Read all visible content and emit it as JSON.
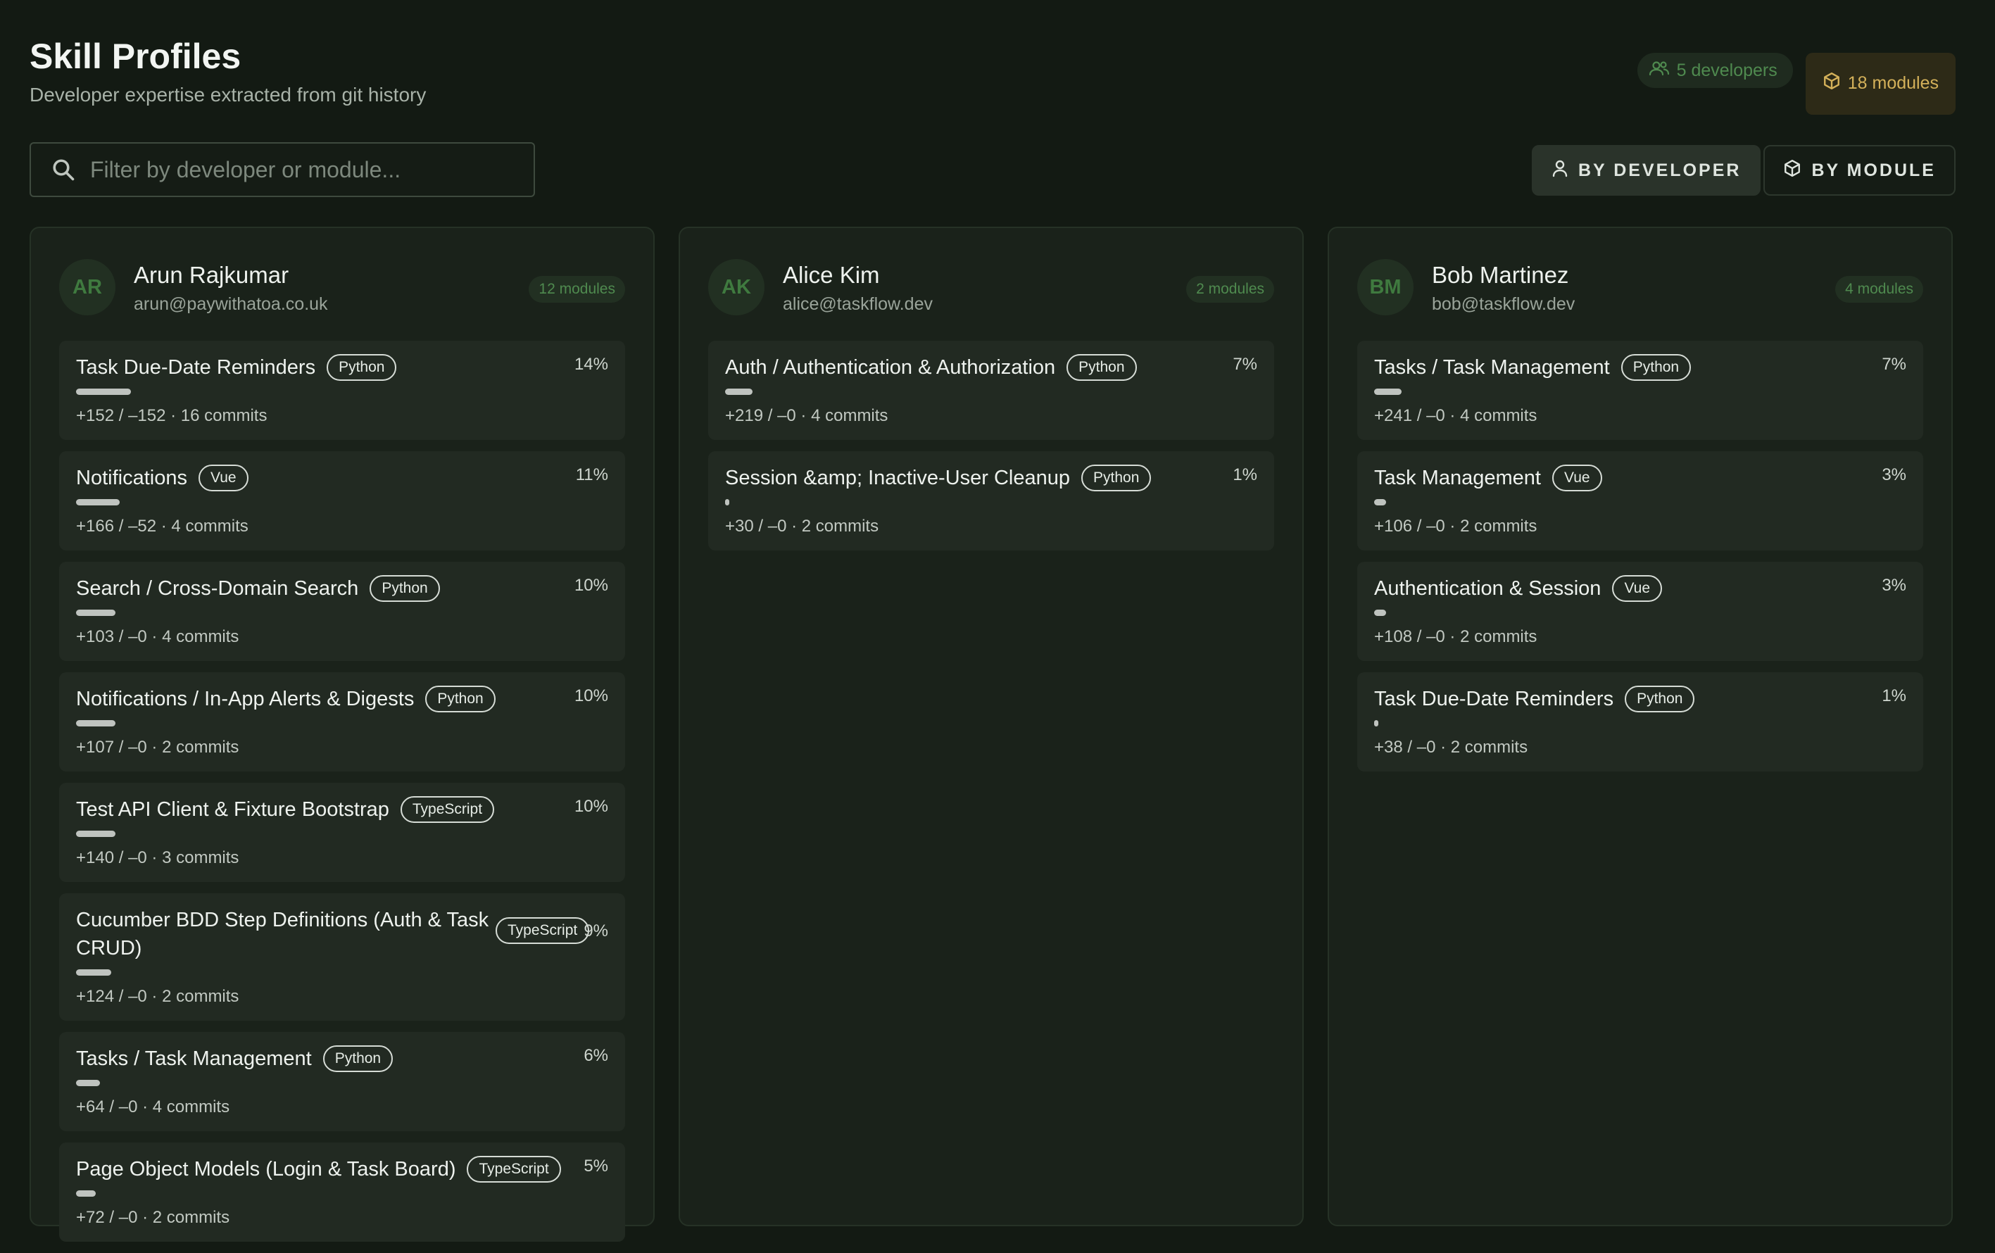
{
  "header": {
    "title": "Skill Profiles",
    "subtitle": "Developer expertise extracted from git history",
    "developers_badge": "5 developers",
    "modules_badge": "18 modules"
  },
  "search": {
    "placeholder": "Filter by developer or module..."
  },
  "view_toggle": {
    "by_developer": "BY DEVELOPER",
    "by_module": "BY MODULE",
    "active": "BY DEVELOPER"
  },
  "colors": {
    "accent_green": "#4f8a4f",
    "accent_gold": "#d4b15a",
    "background": "#131a13"
  },
  "developers": [
    {
      "initials": "AR",
      "name": "Arun Rajkumar",
      "email": "arun@paywithatoa.co.uk",
      "module_count": "12 modules",
      "modules": [
        {
          "name": "Task Due-Date Reminders",
          "lang": "Python",
          "pct": "14%",
          "share": 0.14,
          "stats": "+152 / –152 · 16 commits"
        },
        {
          "name": "Notifications",
          "lang": "Vue",
          "pct": "11%",
          "share": 0.11,
          "stats": "+166 / –52 · 4 commits"
        },
        {
          "name": "Search / Cross-Domain Search",
          "lang": "Python",
          "pct": "10%",
          "share": 0.1,
          "stats": "+103 / –0 · 4 commits"
        },
        {
          "name": "Notifications / In-App Alerts & Digests",
          "lang": "Python",
          "pct": "10%",
          "share": 0.1,
          "stats": "+107 / –0 · 2 commits"
        },
        {
          "name": "Test API Client & Fixture Bootstrap",
          "lang": "TypeScript",
          "pct": "10%",
          "share": 0.1,
          "stats": "+140 / –0 · 3 commits"
        },
        {
          "name": "Cucumber BDD Step Definitions (Auth & Task CRUD)",
          "lang": "TypeScript",
          "pct": "9%",
          "share": 0.09,
          "stats": "+124 / –0 · 2 commits"
        },
        {
          "name": "Tasks / Task Management",
          "lang": "Python",
          "pct": "6%",
          "share": 0.06,
          "stats": "+64 / –0 · 4 commits"
        },
        {
          "name": "Page Object Models (Login & Task Board)",
          "lang": "TypeScript",
          "pct": "5%",
          "share": 0.05,
          "stats": "+72 / –0 · 2 commits"
        }
      ]
    },
    {
      "initials": "AK",
      "name": "Alice Kim",
      "email": "alice@taskflow.dev",
      "module_count": "2 modules",
      "modules": [
        {
          "name": "Auth / Authentication & Authorization",
          "lang": "Python",
          "pct": "7%",
          "share": 0.07,
          "stats": "+219 / –0 · 4 commits"
        },
        {
          "name": "Session &amp; Inactive-User Cleanup",
          "lang": "Python",
          "pct": "1%",
          "share": 0.01,
          "stats": "+30 / –0 · 2 commits"
        }
      ]
    },
    {
      "initials": "BM",
      "name": "Bob Martinez",
      "email": "bob@taskflow.dev",
      "module_count": "4 modules",
      "modules": [
        {
          "name": "Tasks / Task Management",
          "lang": "Python",
          "pct": "7%",
          "share": 0.07,
          "stats": "+241 / –0 · 4 commits"
        },
        {
          "name": "Task Management",
          "lang": "Vue",
          "pct": "3%",
          "share": 0.03,
          "stats": "+106 / –0 · 2 commits"
        },
        {
          "name": "Authentication & Session",
          "lang": "Vue",
          "pct": "3%",
          "share": 0.03,
          "stats": "+108 / –0 · 2 commits"
        },
        {
          "name": "Task Due-Date Reminders",
          "lang": "Python",
          "pct": "1%",
          "share": 0.01,
          "stats": "+38 / –0 · 2 commits"
        }
      ]
    }
  ]
}
